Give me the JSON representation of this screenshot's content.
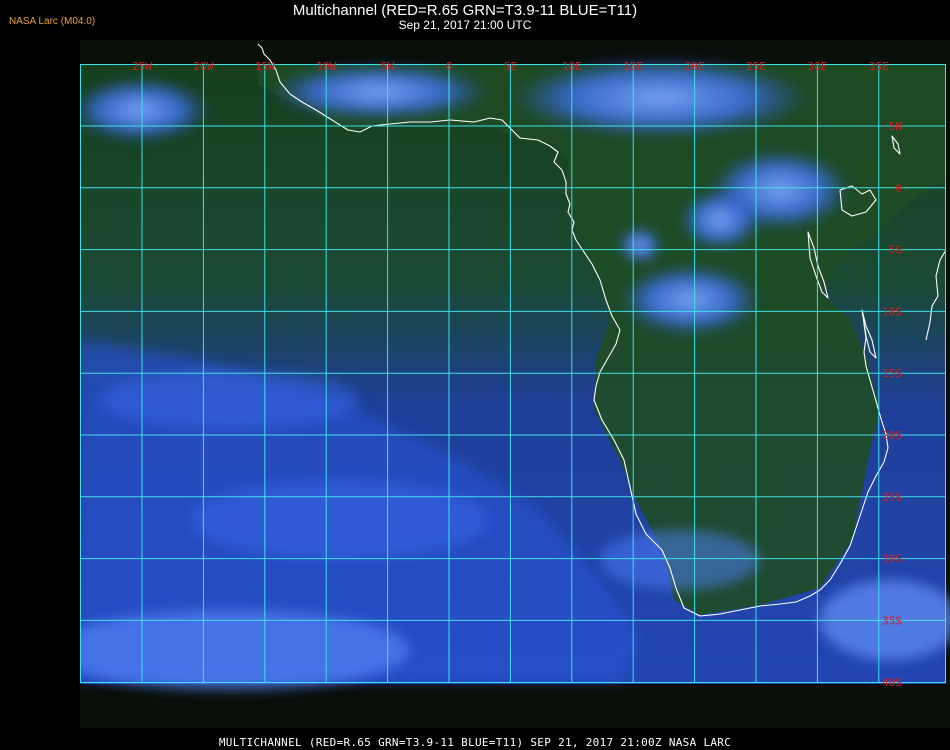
{
  "header": {
    "brand": "NASA Larc (M04.0)",
    "title": "Multichannel (RED=R.65 GRN=T3.9-11 BLUE=T11)",
    "subtitle": "Sep 21, 2017 21:00 UTC"
  },
  "map": {
    "longitude_labels": [
      "25W",
      "20W",
      "15W",
      "10W",
      "5W",
      "0",
      "5E",
      "10E",
      "15E",
      "20E",
      "25E",
      "30E",
      "35E"
    ],
    "latitude_labels": [
      "5N",
      "0",
      "5S",
      "10S",
      "15S",
      "20S",
      "25S",
      "30S",
      "35S",
      "40S"
    ],
    "colors": {
      "grid": "#3fe0e8",
      "tick_labels": "#d02020",
      "coastline": "#ffffff",
      "land_surface": "#1f4a24",
      "ocean_surface": "#1e3f98",
      "cloud": "#4a82ff",
      "brand_text": "#e8a040"
    }
  },
  "footer": {
    "caption": "MULTICHANNEL (RED=R.65 GRN=T3.9-11 BLUE=T11) SEP 21, 2017 21:00Z   NASA LARC"
  }
}
